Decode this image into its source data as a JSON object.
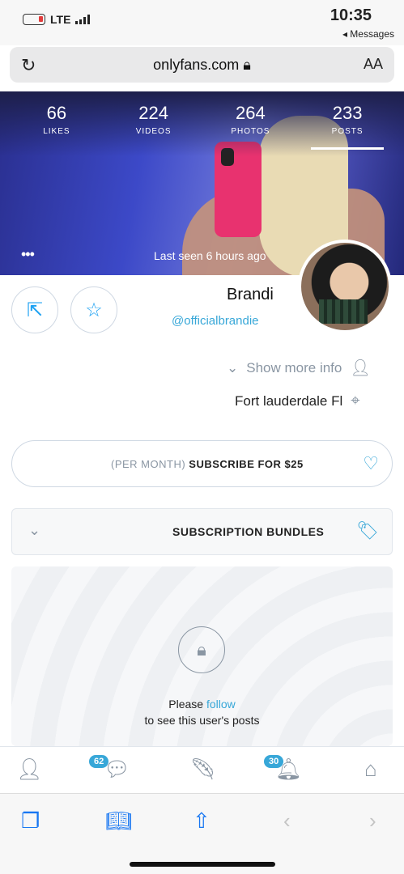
{
  "status_bar": {
    "time": "10:35",
    "network": "LTE",
    "back_label": "◂ Messages"
  },
  "url_bar": {
    "domain": "onlyfans.com",
    "text_size_label": "AA",
    "reload_icon": "reload-icon"
  },
  "stats": [
    {
      "value": "233",
      "label": "POSTS"
    },
    {
      "value": "264",
      "label": "PHOTOS"
    },
    {
      "value": "224",
      "label": "VIDEOS"
    },
    {
      "value": "66",
      "label": "LIKES"
    }
  ],
  "header": {
    "last_seen": "Last seen 6 hours ago",
    "more": "•••"
  },
  "profile": {
    "name": "Brandi",
    "handle": "@officialbrandie",
    "show_more": "Show more info",
    "location": "Fort lauderdale Fl"
  },
  "subscribe": {
    "label": "SUBSCRIBE FOR $25",
    "period": "(PER MONTH)"
  },
  "bundles": {
    "label": "SUBSCRIPTION BUNDLES"
  },
  "locked": {
    "please": "Please",
    "follow": "follow",
    "rest": "to see this user's posts"
  },
  "nav": {
    "messages_badge": "62",
    "notifications_badge": "30"
  },
  "colors": {
    "accent": "#37a7d8",
    "safari_blue": "#1877f2"
  }
}
